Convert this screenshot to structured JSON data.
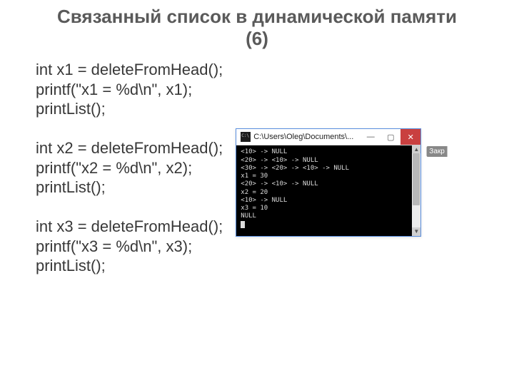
{
  "title_line1": "Связанный список в динамической памяти",
  "title_line2": "(6)",
  "code_lines": [
    "int x1 = deleteFromHead();",
    "printf(\"x1 = %d\\n\", x1);",
    "printList();",
    "",
    "int x2 = deleteFromHead();",
    "printf(\"x2 = %d\\n\", x2);",
    "printList();",
    "",
    "int x3 = deleteFromHead();",
    "printf(\"x3 = %d\\n\", x3);",
    "printList();"
  ],
  "window": {
    "title": "C:\\Users\\Oleg\\Documents\\...",
    "badge": "Закр",
    "min": "—",
    "max": "▢",
    "close": "✕"
  },
  "console_lines": [
    "<10> -> NULL",
    "<20> -> <10> -> NULL",
    "<30> -> <20> -> <10> -> NULL",
    "x1 = 30",
    "<20> -> <10> -> NULL",
    "x2 = 20",
    "<10> -> NULL",
    "x3 = 10",
    "NULL"
  ]
}
